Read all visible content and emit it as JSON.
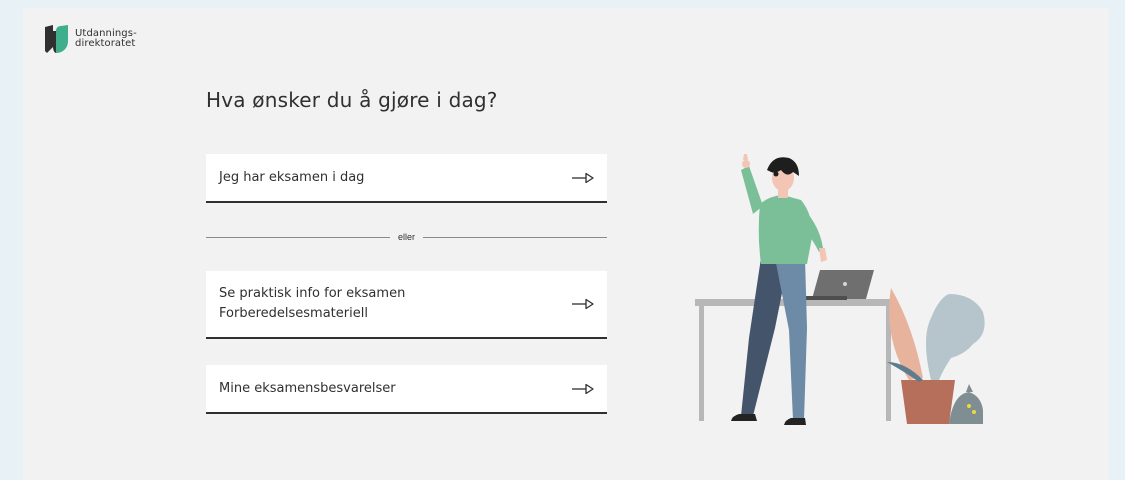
{
  "logo": {
    "line1": "Utdannings-",
    "line2": "direktoratet"
  },
  "heading": "Hva ønsker du å gjøre i dag?",
  "options": [
    {
      "lines": [
        "Jeg har eksamen i dag"
      ],
      "icon": "arrow-right-icon"
    },
    {
      "lines": [
        "Se praktisk info for eksamen",
        "Forberedelsesmateriell"
      ],
      "icon": "arrow-right-icon"
    },
    {
      "lines": [
        "Mine eksamensbesvarelser"
      ],
      "icon": "arrow-right-icon"
    }
  ],
  "divider_text": "eller",
  "colors": {
    "page_background": "#e8f1f6",
    "card_background": "#f2f2f2",
    "text": "#303030",
    "logo_dark": "#303030",
    "logo_accent": "#3fae8c"
  }
}
